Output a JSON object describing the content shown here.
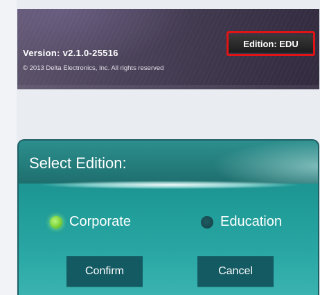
{
  "banner": {
    "version_text": "Version:  v2.1.0-25516",
    "copyright": "© 2013 Delta Electronics, Inc. All rights reserved",
    "edition_button": "Edition: EDU",
    "highlight_color": "#e01414"
  },
  "dialog": {
    "title": "Select Edition:",
    "options": [
      {
        "label": "Corporate",
        "selected": true
      },
      {
        "label": "Education",
        "selected": false
      }
    ],
    "confirm_label": "Confirm",
    "cancel_label": "Cancel",
    "accent_color": "#1f9a97"
  }
}
